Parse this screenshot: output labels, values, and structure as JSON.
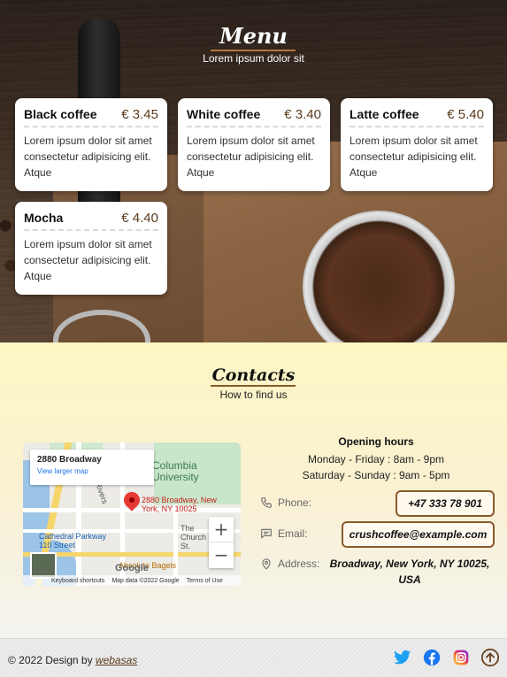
{
  "menu": {
    "title": "Menu",
    "subtitle": "Lorem ipsum dolor sit",
    "items": [
      {
        "name": "Black coffee",
        "price": "€ 3.45",
        "description": "Lorem ipsum dolor sit amet consectetur adipisicing elit. Atque"
      },
      {
        "name": "White coffee",
        "price": "€ 3.40",
        "description": "Lorem ipsum dolor sit amet consectetur adipisicing elit. Atque"
      },
      {
        "name": "Latte coffee",
        "price": "€ 5.40",
        "description": "Lorem ipsum dolor sit amet consectetur adipisicing elit. Atque"
      },
      {
        "name": "Mocha",
        "price": "€ 4.40",
        "description": "Lorem ipsum dolor sit amet consectetur adipisicing elit. Atque"
      }
    ]
  },
  "contacts": {
    "title": "Contacts",
    "subtitle": "How to find us",
    "map": {
      "place_name": "2880 Broadway",
      "view_larger": "View larger map",
      "pin_label": "2880 Broadway, New York, NY 10025",
      "university_label": "Columbia University",
      "station_label": "Cathedral Parkway 110 Street",
      "bagels_label": "Absolute Bagels",
      "church_label": "The Church of St.",
      "street_label": "Rivers",
      "logo": "Google",
      "footer_shortcuts": "Keyboard shortcuts",
      "footer_data": "Map data ©2022 Google",
      "footer_terms": "Terms of Use",
      "zoom_in": "+",
      "zoom_out": "−"
    },
    "hours": {
      "title": "Opening hours",
      "weekdays": "Monday - Friday : 8am - 9pm",
      "weekend": "Saturday - Sunday : 9am - 5pm"
    },
    "phone": {
      "label": "Phone:",
      "value": "+47 333 78 901"
    },
    "email": {
      "label": "Email:",
      "value": "crushcoffee@example.com"
    },
    "address": {
      "label": "Address:",
      "value": "Broadway, New York, NY 10025, USA"
    }
  },
  "footer": {
    "copyright": "© 2022 Design by",
    "designer": "webasas",
    "icons": [
      "twitter-icon",
      "facebook-icon",
      "instagram-icon",
      "arrow-up-icon"
    ]
  },
  "colors": {
    "accent": "#8a5a2b",
    "twitter": "#1da1f2",
    "facebook": "#1877f2",
    "instagram": "#d62976"
  }
}
